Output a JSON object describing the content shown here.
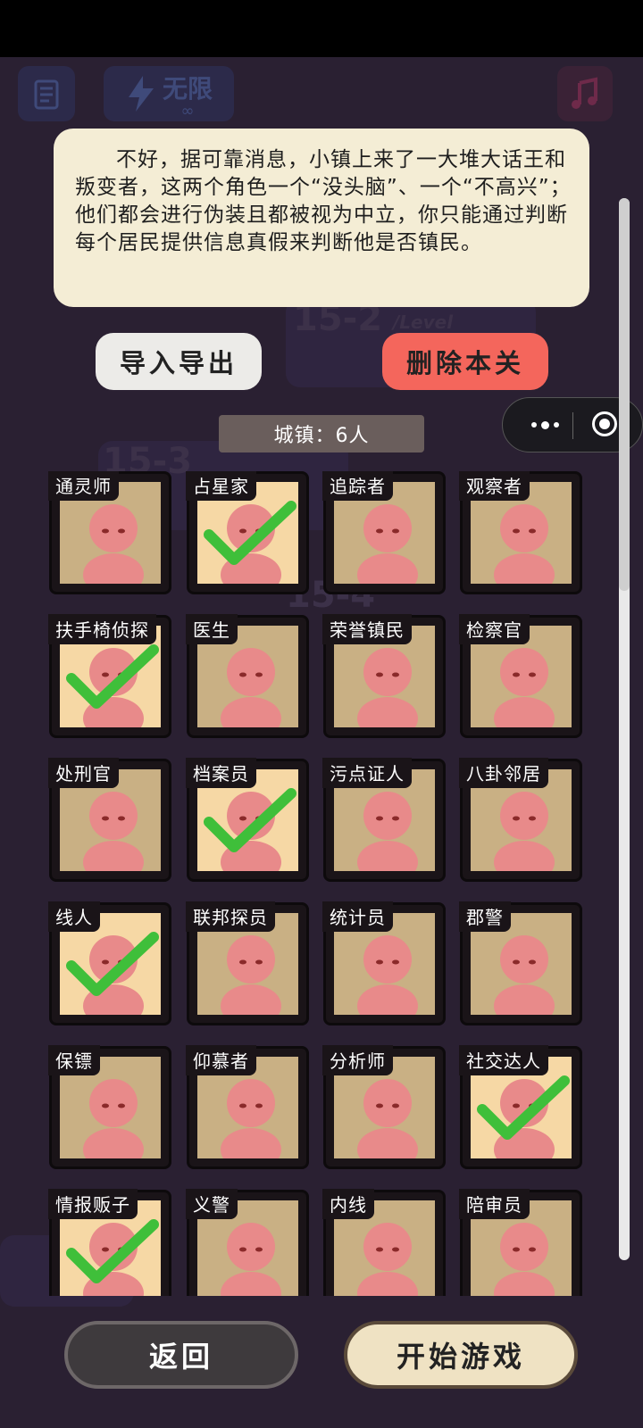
{
  "dialog": {
    "message": "不好，据可靠消息，小镇上来了一大堆大话王和叛变者，这两个角色一个“没头脑”、一个“不高兴”；他们都会进行伪装且都被视为中立，你只能通过判断每个居民提供信息真假来判断他是否镇民。"
  },
  "top_icons": {
    "energy_label": "无限",
    "energy_sub": "∞"
  },
  "buttons": {
    "import_export": "导入导出",
    "delete_level": "删除本关",
    "back": "返回",
    "start_game": "开始游戏"
  },
  "town": {
    "label": "城镇：6人"
  },
  "roles": [
    {
      "name": "通灵师",
      "selected": false
    },
    {
      "name": "占星家",
      "selected": true
    },
    {
      "name": "追踪者",
      "selected": false
    },
    {
      "name": "观察者",
      "selected": false
    },
    {
      "name": "扶手椅侦探",
      "selected": true
    },
    {
      "name": "医生",
      "selected": false
    },
    {
      "name": "荣誉镇民",
      "selected": false
    },
    {
      "name": "检察官",
      "selected": false
    },
    {
      "name": "处刑官",
      "selected": false
    },
    {
      "name": "档案员",
      "selected": true
    },
    {
      "name": "污点证人",
      "selected": false
    },
    {
      "name": "八卦邻居",
      "selected": false
    },
    {
      "name": "线人",
      "selected": true
    },
    {
      "name": "联邦探员",
      "selected": false
    },
    {
      "name": "统计员",
      "selected": false
    },
    {
      "name": "郡警",
      "selected": false
    },
    {
      "name": "保镖",
      "selected": false
    },
    {
      "name": "仰慕者",
      "selected": false
    },
    {
      "name": "分析师",
      "selected": false
    },
    {
      "name": "社交达人",
      "selected": true
    },
    {
      "name": "情报贩子",
      "selected": true
    },
    {
      "name": "义警",
      "selected": false
    },
    {
      "name": "内线",
      "selected": false
    },
    {
      "name": "陪审员",
      "selected": false
    }
  ],
  "background": {
    "level_a": "15-2",
    "level_b": "15-3",
    "level_c": "15-4",
    "level_word": "/Level",
    "back_word": "返回"
  },
  "colors": {
    "check": "#3fbf3a",
    "figure": "#e88a8a",
    "delete": "#f4665c"
  }
}
